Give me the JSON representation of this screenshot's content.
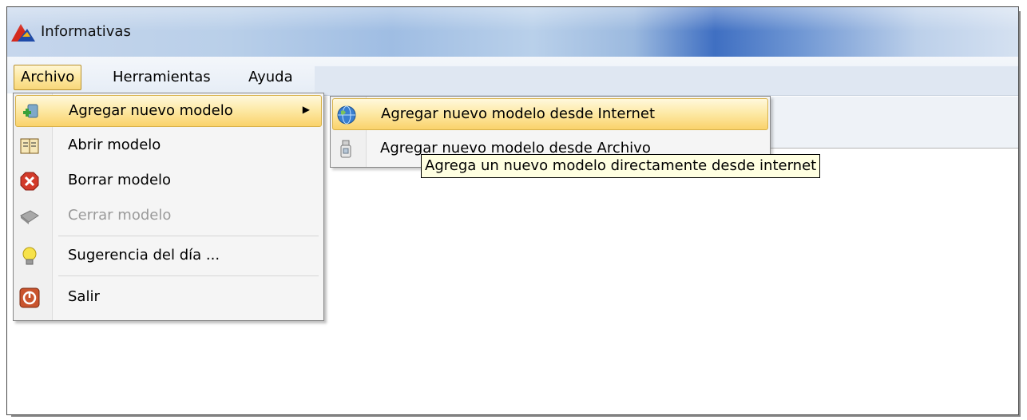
{
  "window": {
    "title": "Informativas"
  },
  "menubar": {
    "items": [
      {
        "label": "Archivo",
        "active": true
      },
      {
        "label": "Herramientas"
      },
      {
        "label": "Ayuda"
      }
    ]
  },
  "archivo_menu": {
    "items": [
      {
        "label": "Agregar nuevo modelo",
        "icon": "add-model-icon",
        "highlighted": true,
        "has_submenu": true
      },
      {
        "label": "Abrir modelo",
        "icon": "open-book-icon"
      },
      {
        "label": "Borrar modelo",
        "icon": "delete-icon"
      },
      {
        "label": "Cerrar modelo",
        "icon": "close-book-icon",
        "disabled": true
      },
      {
        "label": "Sugerencia del día ...",
        "icon": "lightbulb-icon"
      },
      {
        "label": "Salir",
        "icon": "power-icon"
      }
    ]
  },
  "submenu": {
    "items": [
      {
        "label": "Agregar nuevo modelo desde Internet",
        "icon": "globe-icon",
        "highlighted": true
      },
      {
        "label": "Agregar nuevo modelo desde Archivo",
        "icon": "usb-drive-icon"
      }
    ]
  },
  "tooltip": {
    "text": "Agrega un nuevo modelo directamente desde internet"
  },
  "colors": {
    "highlight": "#fad26b",
    "tooltip_bg": "#ffffe1",
    "title_accent": "#3f6fc2"
  }
}
